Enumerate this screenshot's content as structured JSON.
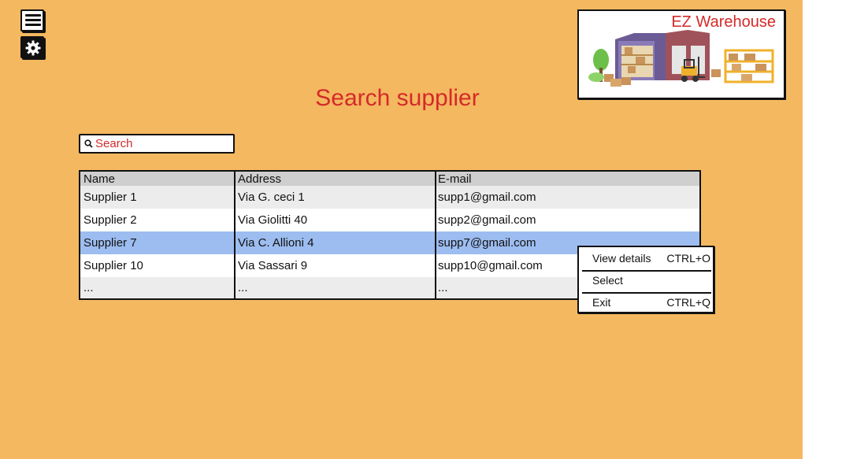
{
  "app": {
    "logo_text": "EZ Warehouse",
    "page_title": "Search supplier",
    "colors": {
      "background": "#f4b860",
      "accent": "#d42a2a",
      "selected_row": "#9dbdf0",
      "header_row": "#cfcfcf",
      "alt_row": "#ececec"
    }
  },
  "toolbar": {
    "menu_icon": "hamburger-menu-icon",
    "settings_icon": "gear-icon"
  },
  "search": {
    "placeholder": "Search",
    "value": ""
  },
  "table": {
    "columns": [
      "Name",
      "Address",
      "E-mail"
    ],
    "rows": [
      {
        "name": "Supplier 1",
        "address": "Via G. ceci 1",
        "email": "supp1@gmail.com",
        "selected": false
      },
      {
        "name": "Supplier 2",
        "address": "Via Giolitti 40",
        "email": "supp2@gmail.com",
        "selected": false
      },
      {
        "name": "Supplier 7",
        "address": "Via C. Allioni 4",
        "email": "supp7@gmail.com",
        "selected": true
      },
      {
        "name": "Supplier 10",
        "address": "Via Sassari 9",
        "email": "supp10@gmail.com",
        "selected": false
      },
      {
        "name": "...",
        "address": "...",
        "email": "...",
        "selected": false
      }
    ]
  },
  "context_menu": {
    "items": [
      {
        "label": "View details",
        "shortcut": "CTRL+O"
      },
      {
        "label": "Select",
        "shortcut": ""
      },
      {
        "label": "Exit",
        "shortcut": "CTRL+Q"
      }
    ]
  }
}
